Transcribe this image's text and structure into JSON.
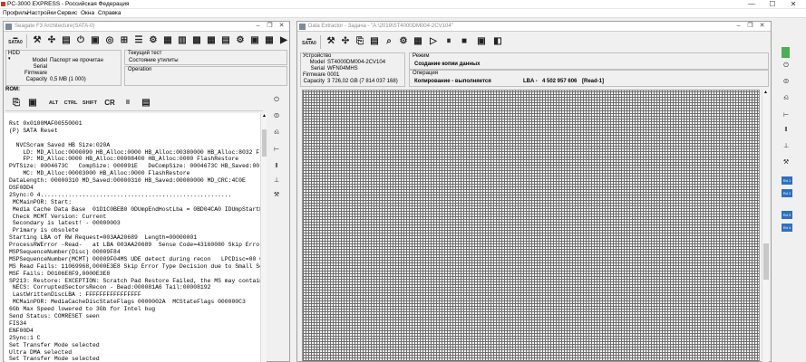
{
  "app": {
    "title": "PC-3000 EXPRESS - Российская Федерация"
  },
  "window_controls": {
    "minimize": "—",
    "maximize": "☐",
    "close": "✕"
  },
  "menu": [
    "Профиль",
    "Настройки",
    "Сервис",
    "Окна",
    "Справка"
  ],
  "left_window": {
    "title": "Seagate F3 Architecture(SATA-0)",
    "toolbar_labels": {
      "sata": "SATA0"
    },
    "hdd_panel": {
      "label": "HDD",
      "fields": [
        {
          "label": "Model",
          "value": "Паспорт не прочитан"
        },
        {
          "label": "Serial",
          "value": ""
        },
        {
          "label": "Firmware",
          "value": ""
        },
        {
          "label": "Capacity",
          "value": "0,5 MB (1 000)"
        }
      ]
    },
    "test_panel": {
      "label": "Текущий тест",
      "value": "Состояние утилиты"
    },
    "operation_panel": {
      "label": "Operation",
      "value": ""
    },
    "rom_label": "ROM:",
    "rom_toolbar": {
      "alt": "ALT",
      "ctrl": "CTRL",
      "shift": "SHIFT",
      "cr": "CR",
      "pause": "II"
    },
    "console_lines": [
      "Rst 0x0100MAF00550001",
      "(P) SATA Reset",
      "",
      "  NVCScram Saved HB Size:020A",
      "    LD: MD_Alloc:0000090 HB_Alloc:0000 HB_Alloc:00380000 HB_Alloc:8032 F",
      "    FP: MD_Alloc:0000 HB_Alloc:00008400 HB_Alloc:0000 FlashRestore",
      "PVTSize: 0004673C   CompSize: 000091E   DeCompSize: 0004673C HB_Saved:00",
      "    MC: MD_Alloc:00003000 HB_Alloc:0000 FlashRestore",
      "DataLength: 00000310 MD_Saved:00000310 HB_Saved:00000000 MD_CRC:4C0E",
      "DSF0DD4",
      "2Sync:0 4.......................................................",
      " MCMainPOR: Start:",
      " Media Cache Data Base  01D1C0BEB0 0DUmpEndHostLba = 0BD04CA0 IDUmpStartH",
      " Check MCMT Version: Current",
      " Secondary is latest! - 00000003",
      " Primary is obsolete",
      "Starting LBA of RW Request=003AA20689  Length=00000001",
      "ProcessRWError -Read-   at LBA 003AA20689  Sense Code=43160080 Skip Error",
      "MSPSequenceNumber(Disc) 00009F84",
      "MSPSequenceNumber(MCMT) 00009F04MS UDE detect during recon   LPCDisc=00 0",
      "MS Read Fails: 11069968,0000E3E8 Skip Error Type Decision due to Small Se",
      "MSF Fails: D0106E8F9,0000E3E8",
      "SP213: Restore: EXCEPTION: Scratch Pad Restore Failed, the MS may contain",
      " NECS: CorruptedSectorsRecon - Bead:000081A6 Tail:00008192",
      " LastWrittenDiscLBA : FFFFFFFFFFFFFFFF",
      " MCMainPOR: MediaCacheDiscStateFlags 0000002A  MCStateFlags 000000C3",
      "6Gb Max Speed lowered to 3Gb for Intel bug",
      "Send Status: COMRESET seen",
      "FIS34",
      "ENF00D4",
      "2Sync:1 C",
      "Set Transfer Mode selected",
      "Ultra DMA selected",
      "Set Transfer Mode selected"
    ]
  },
  "right_window": {
    "title": "Data Extractor - Задача - \"A:\\2019\\ST4000DM004-2CV104\"",
    "device_panel": {
      "label": "Устройство",
      "fields": [
        {
          "label": "Model",
          "value": "ST4000DM004-2CV104"
        },
        {
          "label": "Serial",
          "value": "WFN04MHS"
        },
        {
          "label": "Firmware",
          "value": "0001"
        },
        {
          "label": "Capacity",
          "value": "3 726,02 GB (7 814 037 168)"
        }
      ]
    },
    "mode_panel": {
      "label": "Режим",
      "value": "Создание копии данных"
    },
    "operation_panel": {
      "label": "Операция",
      "value": "Копирование - выполняется",
      "lba_label": "LBA -",
      "lba_value": "4 502 957 606",
      "read_status": "[Read-1]"
    },
    "side_badges": [
      "Rd 1",
      "Rd 2",
      "Rd 3",
      "Rd 4"
    ]
  },
  "colors": {
    "window_border": "#a0a0a0",
    "grid_line": "#6e6e6e",
    "badge_blue": "#2f6fbf"
  }
}
